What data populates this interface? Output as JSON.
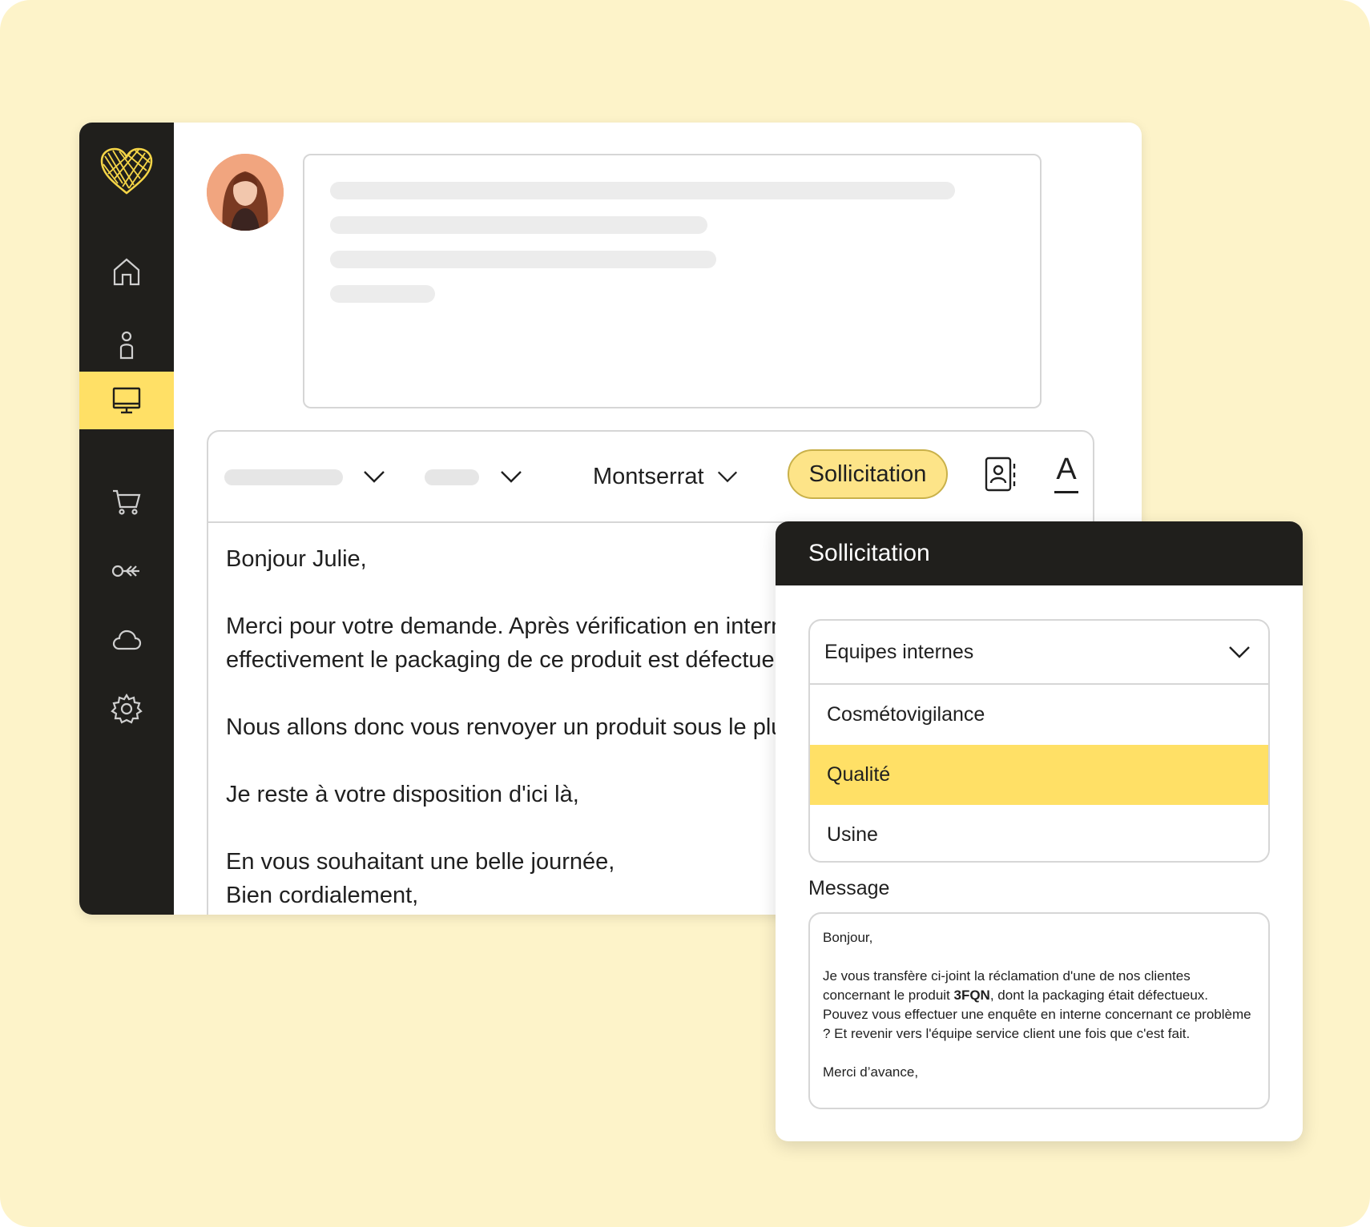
{
  "sidebar": {
    "items": [
      {
        "icon": "home-icon"
      },
      {
        "icon": "person-icon"
      },
      {
        "icon": "monitor-icon",
        "active": true
      },
      {
        "icon": "cart-icon"
      },
      {
        "icon": "key-icon"
      },
      {
        "icon": "cloud-icon"
      },
      {
        "icon": "gear-icon"
      }
    ],
    "accent": "#ffe066",
    "background": "#201f1c"
  },
  "toolbar": {
    "font_label": "Montserrat",
    "sollicitation_label": "Sollicitation",
    "text_format_label": "A"
  },
  "email": {
    "lines": [
      "Bonjour Julie,",
      "",
      "Merci pour votre demande. Après vérification en interne,",
      "effectivement le packaging de ce produit est défectueux.",
      "",
      "Nous allons donc vous renvoyer un produit sous le plus bref délai.",
      "",
      "Je reste à votre disposition d'ici là,",
      "",
      "En vous souhaitant une belle journée,",
      "Bien cordialement,"
    ]
  },
  "panel": {
    "title": "Sollicitation",
    "dropdown": {
      "selected_label": "Equipes internes",
      "options": [
        "Cosmétovigilance",
        "Qualité",
        "Usine"
      ],
      "highlighted": "Qualité"
    },
    "message_label": "Message",
    "message": {
      "greeting": "Bonjour,",
      "body_part1": "Je vous transfère ci-joint la réclamation d'une de nos clientes concernant le produit ",
      "product_code": "3FQN",
      "body_part2": ", dont la packaging était défectueux. Pouvez vous effectuer une enquête en interne concernant ce problème ? Et revenir vers l'équipe service client une fois que c'est fait.",
      "closing": "Merci d’avance,"
    }
  }
}
